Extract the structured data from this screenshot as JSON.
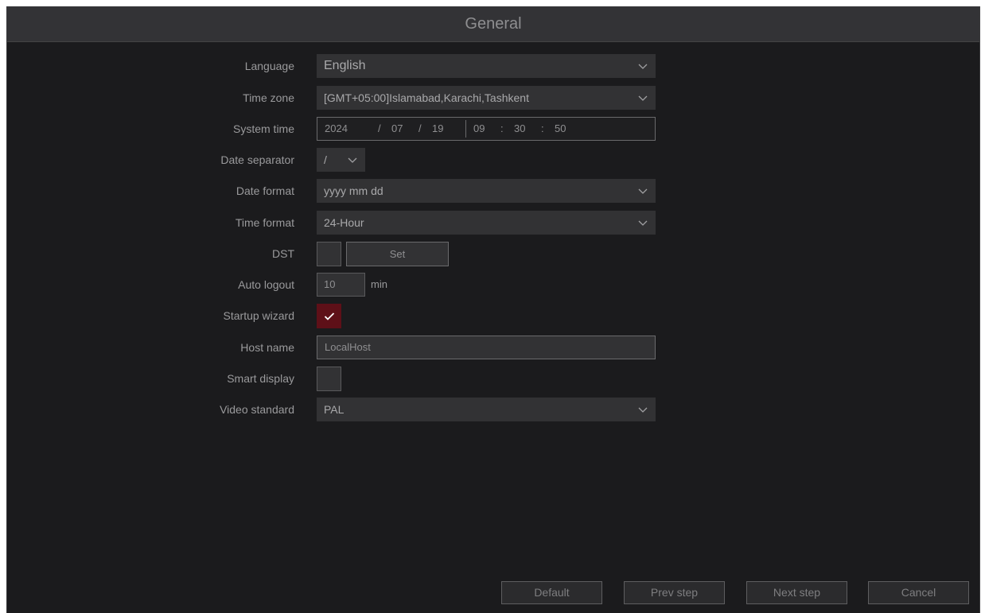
{
  "window": {
    "title": "General"
  },
  "fields": {
    "language": {
      "label": "Language",
      "value": "English"
    },
    "time_zone": {
      "label": "Time zone",
      "value": "[GMT+05:00]Islamabad,Karachi,Tashkent"
    },
    "system_time": {
      "label": "System time",
      "year": "2024",
      "sep1": "/",
      "month": "07",
      "sep2": "/",
      "day": "19",
      "hour": "09",
      "colon1": ":",
      "minute": "30",
      "colon2": ":",
      "second": "50"
    },
    "date_separator": {
      "label": "Date separator",
      "value": "/"
    },
    "date_format": {
      "label": "Date format",
      "value": "yyyy mm dd"
    },
    "time_format": {
      "label": "Time format",
      "value": "24-Hour"
    },
    "dst": {
      "label": "DST",
      "checked": false,
      "set_button": "Set"
    },
    "auto_logout": {
      "label": "Auto logout",
      "value": "10",
      "unit": "min"
    },
    "startup_wizard": {
      "label": "Startup wizard",
      "checked": true
    },
    "host_name": {
      "label": "Host name",
      "value": "LocalHost"
    },
    "smart_display": {
      "label": "Smart display",
      "checked": false
    },
    "video_standard": {
      "label": "Video standard",
      "value": "PAL"
    }
  },
  "footer": {
    "default": "Default",
    "prev": "Prev step",
    "next": "Next step",
    "cancel": "Cancel"
  },
  "colors": {
    "background": "#1b1b1d",
    "titlebar": "#333336",
    "control": "#323234",
    "checked": "#5e1018",
    "text": "#9a9a9c"
  }
}
